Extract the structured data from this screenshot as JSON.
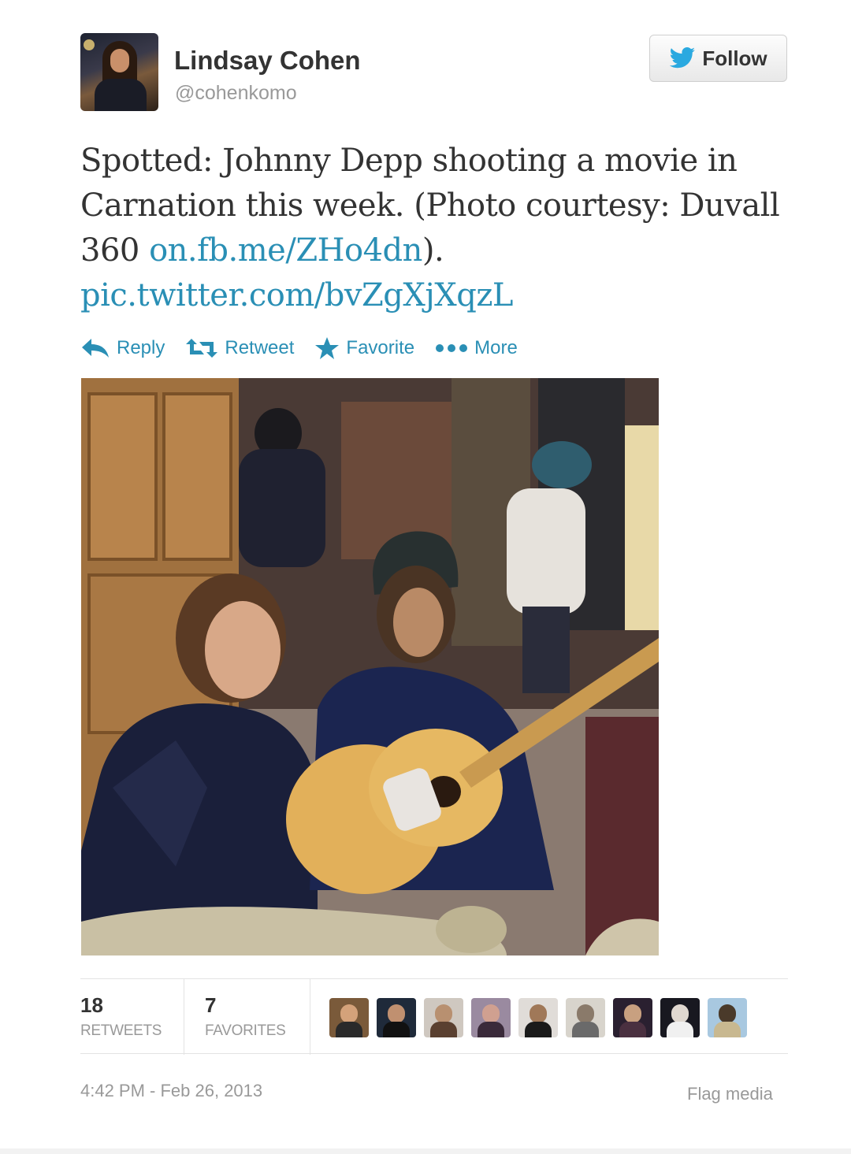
{
  "author": {
    "name": "Lindsay Cohen",
    "handle": "@cohenkomo"
  },
  "follow_button": {
    "label": "Follow"
  },
  "tweet": {
    "text_lines": [
      "Spotted: Johnny Depp shooting a movie in",
      "Carnation this week. (Photo courtesy: Duvall",
      "360 "
    ],
    "link1": "on.fb.me/ZHo4dn",
    "link1_suffix": ").",
    "link2": "pic.twitter.com/bvZgXjXqzL"
  },
  "actions": {
    "reply": "Reply",
    "retweet": "Retweet",
    "favorite": "Favorite",
    "more": "More"
  },
  "stats": {
    "retweets_count": "18",
    "retweets_label": "RETWEETS",
    "favorites_count": "7",
    "favorites_label": "FAVORITES"
  },
  "timestamp": "4:42 PM - Feb 26, 2013",
  "flag_media": "Flag media",
  "colors": {
    "link": "#2a8fb5",
    "muted": "#999999",
    "text": "#333333",
    "twitter_bird": "#2aa9e0"
  }
}
